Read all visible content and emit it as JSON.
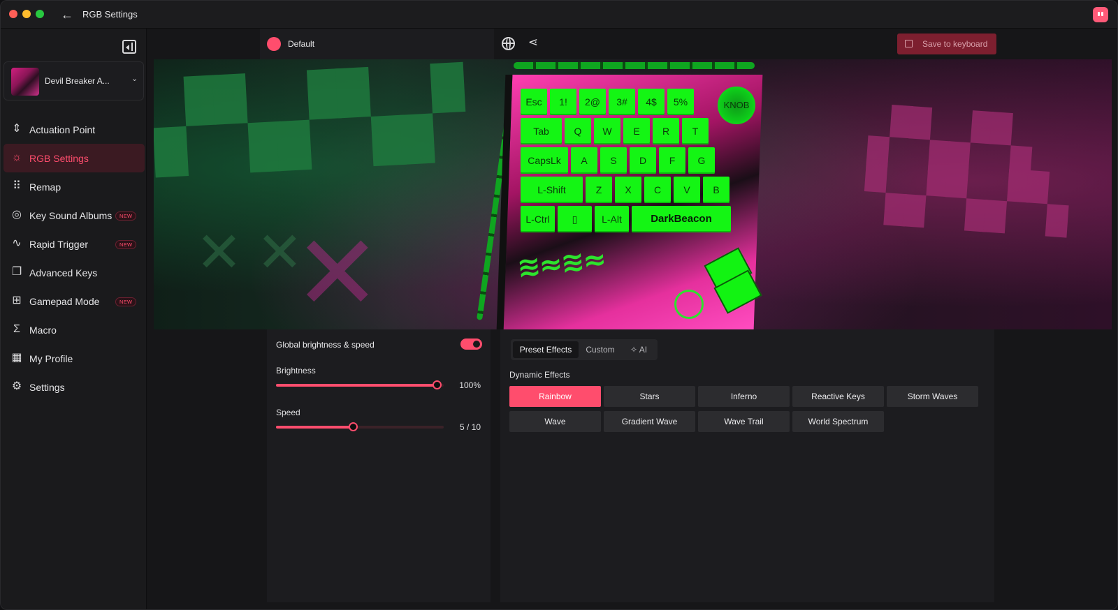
{
  "window": {
    "title": "RGB Settings"
  },
  "device": {
    "name": "Devil Breaker A..."
  },
  "sidebar": {
    "items": [
      {
        "label": "Actuation Point",
        "icon": "actuation-icon",
        "new": ""
      },
      {
        "label": "RGB Settings",
        "icon": "sun-icon",
        "new": ""
      },
      {
        "label": "Remap",
        "icon": "keyboard-icon",
        "new": ""
      },
      {
        "label": "Key Sound Albums",
        "icon": "disc-icon",
        "new": "NEW"
      },
      {
        "label": "Rapid Trigger",
        "icon": "pulse-icon",
        "new": "NEW"
      },
      {
        "label": "Advanced Keys",
        "icon": "layers-icon",
        "new": ""
      },
      {
        "label": "Gamepad Mode",
        "icon": "gamepad-icon",
        "new": "NEW"
      },
      {
        "label": "Macro",
        "icon": "sigma-icon",
        "new": ""
      },
      {
        "label": "My Profile",
        "icon": "grid-icon",
        "new": ""
      },
      {
        "label": "Settings",
        "icon": "gear-icon",
        "new": ""
      }
    ],
    "active_index": 1
  },
  "toolbar": {
    "profile_name": "Default",
    "save_label": "Save to keyboard"
  },
  "keyboard": {
    "row1": [
      "Esc",
      "1!",
      "2@",
      "3#",
      "4$",
      "5%"
    ],
    "knob": "KNOB",
    "row2": [
      "Tab",
      "Q",
      "W",
      "E",
      "R",
      "T"
    ],
    "row3": [
      "CapsLk",
      "A",
      "S",
      "D",
      "F",
      "G"
    ],
    "row4": [
      "L-Shift",
      "Z",
      "X",
      "C",
      "V",
      "B"
    ],
    "row5": [
      "L-Ctrl",
      "",
      "L-Alt",
      "DarkBeacon"
    ]
  },
  "lighting": {
    "global_label": "Global brightness & speed",
    "global_enabled": true,
    "brightness_label": "Brightness",
    "brightness_value": "100%",
    "brightness_percent": 100,
    "speed_label": "Speed",
    "speed_value": "5 / 10",
    "speed_level": 5,
    "speed_max": 10
  },
  "effects": {
    "tabs": [
      "Preset Effects",
      "Custom",
      "AI"
    ],
    "active_tab": 0,
    "section_title": "Dynamic Effects",
    "items": [
      "Rainbow",
      "Stars",
      "Inferno",
      "Reactive Keys",
      "Storm Waves",
      "Wave",
      "Gradient Wave",
      "Wave Trail",
      "World Spectrum"
    ],
    "active_index": 0
  },
  "colors": {
    "accent": "#ff4d6d",
    "key_green": "#14f514",
    "profile_dot": "#ff4d6d"
  }
}
